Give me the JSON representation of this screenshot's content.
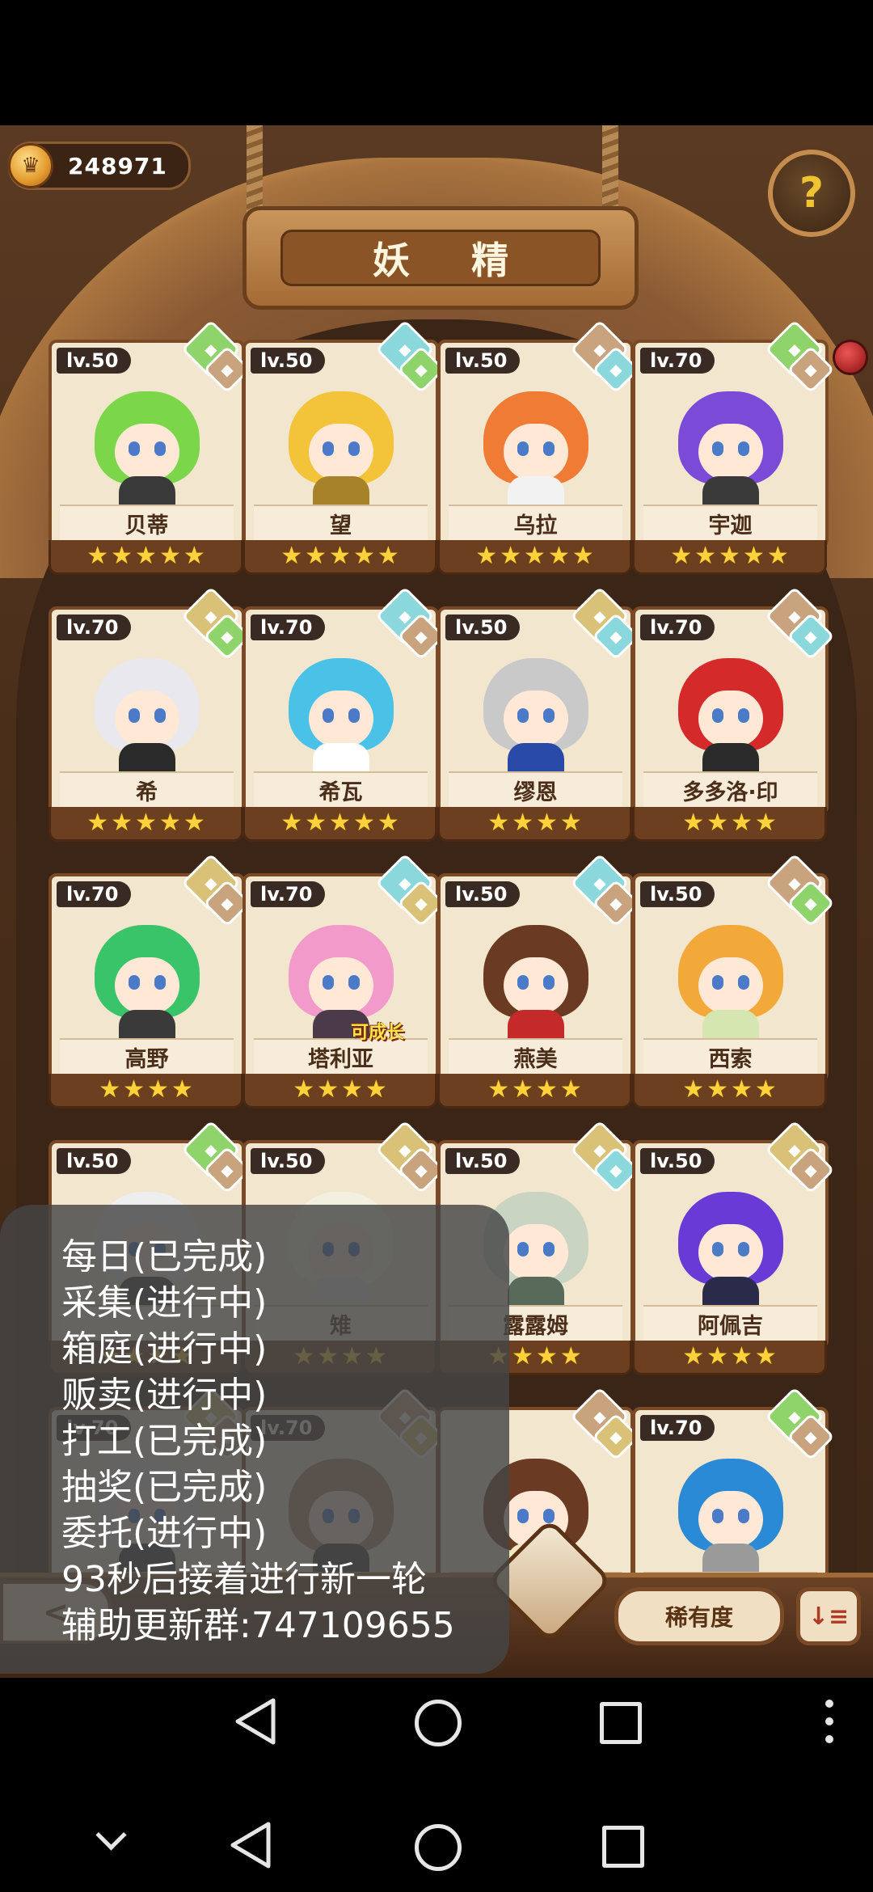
{
  "header": {
    "currency_value": "248971",
    "title": "妖 精",
    "help_icon": "question-mark-sprout-icon"
  },
  "cards": [
    {
      "level": "lv.50",
      "name": "贝蒂",
      "stars": 5,
      "hair": "#7bd64a",
      "outfit": "#3a3a3a",
      "gems": [
        "#8fd46a",
        "#c9a27e"
      ]
    },
    {
      "level": "lv.50",
      "name": "望",
      "stars": 5,
      "hair": "#f3c43a",
      "outfit": "#a8822a",
      "gems": [
        "#8ad7dc",
        "#8fd46a"
      ]
    },
    {
      "level": "lv.50",
      "name": "乌拉",
      "stars": 5,
      "hair": "#f07b34",
      "outfit": "#f2f2f2",
      "gems": [
        "#c9a27e",
        "#8ad7dc"
      ]
    },
    {
      "level": "lv.70",
      "name": "宇迦",
      "stars": 5,
      "hair": "#7b4ad6",
      "outfit": "#3a3a3a",
      "gems": [
        "#8fd46a",
        "#c9a27e"
      ]
    },
    {
      "level": "lv.70",
      "name": "希",
      "stars": 5,
      "hair": "#e8e8ee",
      "outfit": "#2a2a2a",
      "gems": [
        "#d9c277",
        "#8fd46a"
      ]
    },
    {
      "level": "lv.70",
      "name": "希瓦",
      "stars": 5,
      "hair": "#4ac2e8",
      "outfit": "#ffffff",
      "gems": [
        "#8ad7dc",
        "#c9a27e"
      ]
    },
    {
      "level": "lv.50",
      "name": "缪恩",
      "stars": 4,
      "hair": "#c9c9c9",
      "outfit": "#2a4aa8",
      "gems": [
        "#d9c277",
        "#8ad7dc"
      ]
    },
    {
      "level": "lv.70",
      "name": "多多洛·印",
      "stars": 4,
      "hair": "#d42a2a",
      "outfit": "#2a2a2a",
      "gems": [
        "#c9a27e",
        "#8ad7dc"
      ]
    },
    {
      "level": "lv.70",
      "name": "高野",
      "stars": 4,
      "hair": "#3ac46a",
      "outfit": "#3a3a3a",
      "gems": [
        "#d9c277",
        "#c9a27e"
      ]
    },
    {
      "level": "lv.70",
      "name": "塔利亚",
      "stars": 4,
      "hair": "#f29ac9",
      "outfit": "#4a3a4a",
      "gems": [
        "#8ad7dc",
        "#d9c277"
      ],
      "tag": "可成长"
    },
    {
      "level": "lv.50",
      "name": "燕美",
      "stars": 4,
      "hair": "#6a3a22",
      "outfit": "#c42a2a",
      "gems": [
        "#8ad7dc",
        "#c9a27e"
      ]
    },
    {
      "level": "lv.50",
      "name": "西索",
      "stars": 4,
      "hair": "#f3a83a",
      "outfit": "#d6e6b0",
      "gems": [
        "#c9a27e",
        "#8fd46a"
      ]
    },
    {
      "level": "lv.50",
      "name": "",
      "stars": 4,
      "hair": "#eeeeee",
      "outfit": "#3a3a3a",
      "gems": [
        "#8fd46a",
        "#c9a27e"
      ]
    },
    {
      "level": "lv.50",
      "name": "雉",
      "stars": 4,
      "hair": "#f4f0e0",
      "outfit": "#e6e6e6",
      "gems": [
        "#d9c277",
        "#c9a27e"
      ]
    },
    {
      "level": "lv.50",
      "name": "露露姆",
      "stars": 4,
      "hair": "#c9d4c2",
      "outfit": "#5a6a5a",
      "gems": [
        "#d9c277",
        "#8ad7dc"
      ]
    },
    {
      "level": "lv.50",
      "name": "阿佩吉",
      "stars": 4,
      "hair": "#6a3ad6",
      "outfit": "#2a2a4a",
      "gems": [
        "#d9c277",
        "#c9a27e"
      ]
    },
    {
      "level": "lv.70",
      "name": "",
      "stars": 0,
      "hair": "#e8e8e8",
      "outfit": "#3a3a3a",
      "gems": [
        "#d9c277",
        "#c9a27e"
      ]
    },
    {
      "level": "lv.70",
      "name": "",
      "stars": 0,
      "hair": "#b08a6a",
      "outfit": "#3a3a3a",
      "gems": [
        "#c9a27e",
        "#d9c277"
      ]
    },
    {
      "level": "",
      "name": "",
      "stars": 0,
      "hair": "#6a3a22",
      "outfit": "#f4e6c2",
      "gems": [
        "#c9a27e",
        "#d9c277"
      ]
    },
    {
      "level": "lv.70",
      "name": "",
      "stars": 0,
      "hair": "#2a8ad6",
      "outfit": "#9a9a9a",
      "gems": [
        "#8fd46a",
        "#c9a27e"
      ]
    }
  ],
  "bottom": {
    "back_label": "<",
    "rarity_label": "稀有度",
    "sort_icon": "sort-descending-icon"
  },
  "overlay": {
    "lines": [
      "每日(已完成)",
      "采集(进行中)",
      "箱庭(进行中)",
      "贩卖(进行中)",
      "打工(已完成)",
      "抽奖(已完成)",
      "委托(进行中)",
      "93秒后接着进行新一轮",
      "辅助更新群:747109655"
    ]
  }
}
